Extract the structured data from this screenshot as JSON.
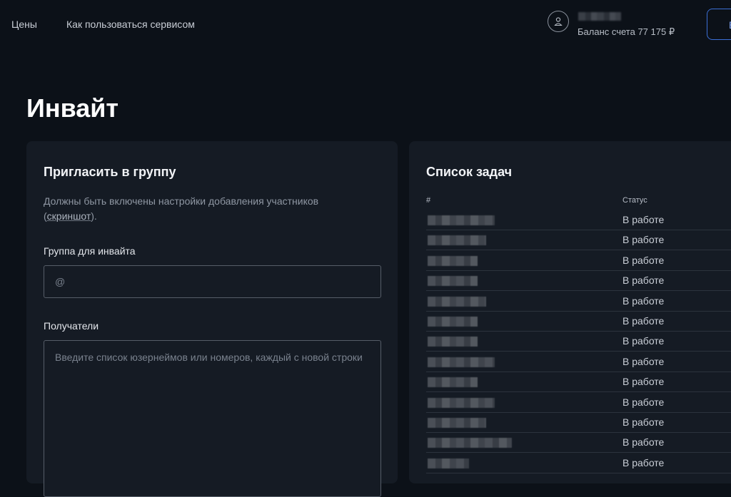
{
  "nav": {
    "links": [
      "Цены",
      "Как пользоваться сервисом"
    ]
  },
  "user": {
    "balance_label": "Баланс счета 77 175 ₽"
  },
  "page": {
    "title": "Инвайт"
  },
  "invite_card": {
    "title": "Пригласить в группу",
    "hint_text": "Должны быть включены настройки добавления участников (",
    "hint_link": "скриншот",
    "hint_end": ").",
    "group_label": "Группа для инвайта",
    "group_placeholder": "@",
    "recipients_label": "Получатели",
    "recipients_placeholder": "Введите список юзернеймов или номеров, каждый с новой строки"
  },
  "tasks_card": {
    "title": "Список задач",
    "columns": [
      "#",
      "Статус"
    ],
    "rows": [
      {
        "status": "В работе"
      },
      {
        "status": "В работе"
      },
      {
        "status": "В работе"
      },
      {
        "status": "В работе"
      },
      {
        "status": "В работе"
      },
      {
        "status": "В работе"
      },
      {
        "status": "В работе"
      },
      {
        "status": "В работе"
      },
      {
        "status": "В работе"
      },
      {
        "status": "В работе"
      },
      {
        "status": "В работе"
      },
      {
        "status": "В работе"
      },
      {
        "status": "В работе"
      }
    ]
  },
  "colors": {
    "background": "#0c1118",
    "card": "#151b24",
    "accent": "#3b6fd6"
  }
}
